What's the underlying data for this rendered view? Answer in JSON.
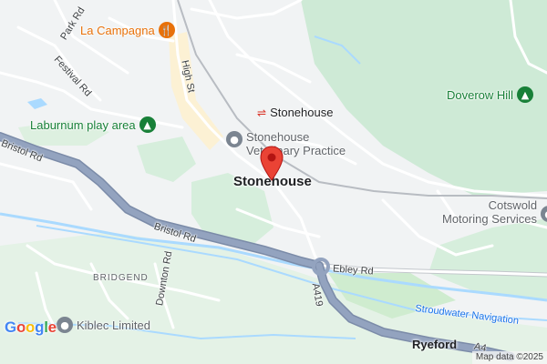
{
  "map": {
    "pois": {
      "la_campagna": {
        "name": "La Campagna",
        "icon": "restaurant-icon",
        "color": "#e8710a"
      },
      "laburnum": {
        "name": "Laburnum play area",
        "icon": "tree-icon",
        "color": "#188038"
      },
      "doverow": {
        "name": "Doverow Hill",
        "icon": "tree-icon",
        "color": "#188038"
      },
      "stonehouse_station": {
        "name": "Stonehouse",
        "icon": "train-station-icon",
        "color": "#d93025"
      },
      "vet": {
        "name": "Stonehouse Veterinary Practice",
        "line1": "Stonehouse",
        "line2": "Veterinary Practice",
        "icon": "pin-icon",
        "color": "#7b8591"
      },
      "cotswold": {
        "name": "Cotswold Motoring Services",
        "line1": "Cotswold",
        "line2": "Motoring Services",
        "icon": "pin-icon",
        "color": "#7b8591"
      },
      "kiblec": {
        "name": "Kiblec Limited",
        "icon": "pin-icon",
        "color": "#7b8591"
      }
    },
    "places": {
      "town": "Stonehouse",
      "ryeford": "Ryeford",
      "bridgend": "BRIDGEND"
    },
    "roads": {
      "park_rd": "Park Rd",
      "festival_rd": "Festival Rd",
      "high_st": "High St",
      "bristol_rd_1": "Bristol Rd",
      "bristol_rd_2": "Bristol Rd",
      "downton_rd": "Downton Rd",
      "ebley_rd": "Ebley Rd",
      "a419": "A419",
      "a419_end": "A4",
      "stroudwater": "Stroudwater Navigation"
    },
    "marker": {
      "icon": "location-marker-icon",
      "color": "#ea4335"
    },
    "logo": {
      "text": "Google",
      "colors": [
        "#4285f4",
        "#ea4335",
        "#fbbc05",
        "#4285f4",
        "#34a853",
        "#ea4335"
      ]
    },
    "attribution": "Map data ©2025"
  }
}
